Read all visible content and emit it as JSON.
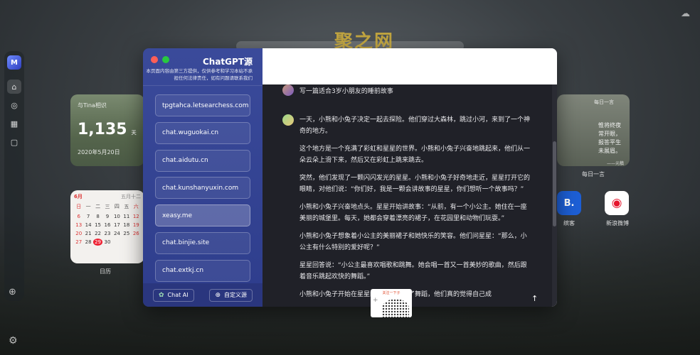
{
  "watermark": "聚之网",
  "dock": {
    "logo": "M",
    "items": [
      {
        "icon": "home-icon",
        "glyph": "⌂"
      },
      {
        "icon": "compass-icon",
        "glyph": "◎"
      },
      {
        "icon": "calendar-icon",
        "glyph": "▦"
      },
      {
        "icon": "bookmark-icon",
        "glyph": "▢"
      }
    ],
    "add_glyph": "⊕",
    "settings_glyph": "⚙"
  },
  "widget_days": {
    "title": "与Tina相识",
    "count": "1,135",
    "unit": "天",
    "date": "2020年5月20日"
  },
  "calendar": {
    "month": "6月",
    "lunar": "五月十二",
    "weekdays": [
      "日",
      "一",
      "二",
      "三",
      "四",
      "五",
      "六"
    ],
    "days": [
      "",
      "",
      "",
      "",
      "",
      "",
      "",
      "6",
      "7",
      "8",
      "9",
      "10",
      "11",
      "12",
      "13",
      "14",
      "15",
      "16",
      "17",
      "18",
      "19",
      "20",
      "21",
      "22",
      "23",
      "24",
      "25",
      "26",
      "27",
      "28",
      "29",
      "30",
      "",
      ""
    ],
    "today": "29",
    "label": "日历"
  },
  "widget_quote": {
    "top": "每日一言",
    "text": "惟将终夜常开眼，报答平生未展眉。",
    "by": "——元稹",
    "label": "每日一言"
  },
  "apps": [
    {
      "name": "缤客",
      "glyph": "B."
    },
    {
      "name": "新浪微博",
      "glyph": "◉"
    }
  ],
  "window": {
    "title": "ChatGPT源",
    "notice": "本页面内容由第三方提供，仅供参考和学习本站不承担任何法律责任，如有问题请联系我们",
    "sources": [
      "tpgtahca.letsearchess.com",
      "chat.wuguokai.cn",
      "chat.aidutu.cn",
      "chat.kunshanyuxin.com",
      "xeasy.me",
      "chat.binjie.site",
      "chat.extkj.cn"
    ],
    "selected_source": "xeasy.me",
    "footer_left": "Chat AI",
    "footer_right": "自定义源",
    "user_message": "写一篇适合3岁小朋友的睡前故事",
    "bot_paragraphs": [
      "一天，小熊和小兔子决定一起去探险。他们穿过大森林，跳过小河，来到了一个神奇的地方。",
      "这个地方是一个充满了彩虹和星星的世界。小熊和小兔子兴奋地跳起来，他们从一朵云朵上滑下来，然后又在彩虹上跳来跳去。",
      "突然，他们发现了一颗闪闪发光的星星。小熊和小兔子好奇地走近，星星打开它的眼睛，对他们说：“你们好，我是一颗会讲故事的星星，你们想听一个故事吗？”",
      "小熊和小兔子兴奋地点头。星星开始讲故事：“从前，有一个小公主。她住在一座美丽的城堡里。每天，她都会穿着漂亮的裙子，在花园里和动物们玩耍。”",
      "小熊和小兔子想象着小公主的美丽裙子和她快乐的笑容。他们问星星：“那么，小公主有什么特别的爱好呢？”",
      "星星回答说：“小公主最喜欢唱歌和跳舞。她会唱一首又一首美妙的歌曲，然后跟着音乐跳起欢快的舞蹈。”",
      "小熊和小兔子开始在星星的引导下跳起了舞蹈，他们真的觉得自己成"
    ],
    "promo_title": "关注一下子"
  }
}
